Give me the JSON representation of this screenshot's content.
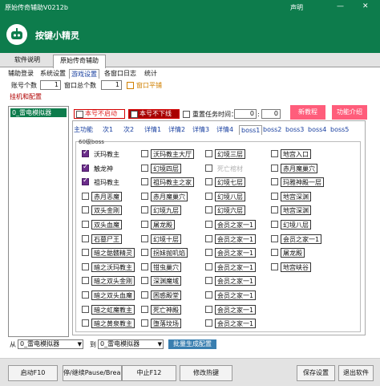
{
  "window": {
    "title": "原始传奇辅助V0212b",
    "announce_label": "声明",
    "min_icon": "minimize-icon",
    "close_icon": "close-icon"
  },
  "header": {
    "brand": "按键小精灵",
    "brand_color": "#0d7c4c"
  },
  "main_tabs": [
    "软件说明",
    "原始传奇辅助"
  ],
  "sub_tabs": [
    "辅助登录",
    "系统设置",
    "游戏设置",
    "各窗口日志",
    "统计"
  ],
  "settings": {
    "account_count_label": "账号个数",
    "account_count_value": "1",
    "window_total_label": "窗口总个数",
    "window_total_value": "1",
    "window_tile_label": "窗口平铺",
    "hang_config_tab": "挂机和配置"
  },
  "left_list": {
    "items": [
      "0_雷电模拟器"
    ]
  },
  "options": {
    "no_start_label": "本号不启动",
    "no_offline_label": "本号不下线",
    "restart_task_time_label": "重置任务时间：",
    "restart_hour": "0",
    "restart_min": "0",
    "new_tutorial": "新教程",
    "feature_intro": "功能介绍"
  },
  "function_tabs": [
    "主功能",
    "次1",
    "次2",
    "详情1",
    "详情2",
    "详情3",
    "详情4",
    "boss1",
    "boss2",
    "boss3",
    "boss4",
    "boss5"
  ],
  "boss_group_title": "60级boss",
  "boss_columns": [
    [
      {
        "label": "沃玛教主",
        "checked": true
      },
      {
        "label": "触龙神",
        "checked": true
      },
      {
        "label": "祖玛教主",
        "checked": true
      },
      {
        "label": "赤月恶魔",
        "checked": false
      },
      {
        "label": "双头金刚",
        "checked": false
      },
      {
        "label": "双头血魔",
        "checked": false
      },
      {
        "label": "石墓尸王",
        "checked": false
      },
      {
        "label": "暗之骷髅精灵",
        "checked": false
      },
      {
        "label": "暗之沃玛教主",
        "checked": false
      },
      {
        "label": "暗之双头金刚",
        "checked": false
      },
      {
        "label": "暗之双头血魔",
        "checked": false
      },
      {
        "label": "暗之虹魔教主",
        "checked": false
      },
      {
        "label": "暗之黄泉教主",
        "checked": false
      }
    ],
    [
      {
        "label": "沃玛教主大厅",
        "checked": false
      },
      {
        "label": "幻境四层",
        "checked": false
      },
      {
        "label": "祖玛教主之家",
        "checked": false
      },
      {
        "label": "赤月魔巢穴",
        "checked": false
      },
      {
        "label": "幻境九层",
        "checked": false
      },
      {
        "label": "屠龙殿",
        "checked": false
      },
      {
        "label": "幻境十层",
        "checked": false
      },
      {
        "label": "拐妹抛叽焰",
        "checked": false
      },
      {
        "label": "钳虫巢穴",
        "checked": false
      },
      {
        "label": "深渊魔域",
        "checked": false
      },
      {
        "label": "困惑殿堂",
        "checked": false
      },
      {
        "label": "死亡神殿",
        "checked": false
      },
      {
        "label": "堕落坟场",
        "checked": false
      }
    ],
    [
      {
        "label": "幻境三层",
        "checked": false
      },
      {
        "label": "死亡棺材",
        "checked": false,
        "disabled": true
      },
      {
        "label": "幻境七层",
        "checked": false
      },
      {
        "label": "幻境八层",
        "checked": false
      },
      {
        "label": "幻境六层",
        "checked": false
      },
      {
        "label": "会员之家一1",
        "checked": false
      },
      {
        "label": "会员之家一1",
        "checked": false
      },
      {
        "label": "会员之家一1",
        "checked": false
      },
      {
        "label": "会员之家一1",
        "checked": false
      },
      {
        "label": "会员之家一1",
        "checked": false
      },
      {
        "label": "会员之家一1",
        "checked": false
      },
      {
        "label": "会员之家一1",
        "checked": false
      },
      {
        "label": "会员之家一1",
        "checked": false
      }
    ],
    [
      {
        "label": "地宫入口",
        "checked": false
      },
      {
        "label": "赤月魔巢穴",
        "checked": false
      },
      {
        "label": "玛雅神殿一层",
        "checked": false
      },
      {
        "label": "地宫深渊",
        "checked": false
      },
      {
        "label": "地宫深渊",
        "checked": false
      },
      {
        "label": "幻境八层",
        "checked": false
      },
      {
        "label": "会员之家一1",
        "checked": false
      },
      {
        "label": "屠龙殿",
        "checked": false
      },
      {
        "label": "地宫峡谷",
        "checked": false
      }
    ]
  ],
  "bottom": {
    "from_label": "从",
    "from_value": "0_雷电模拟器",
    "to_label": "到",
    "to_value": "0_雷电模拟器",
    "batch_generate": "批量生成配置"
  },
  "footer": {
    "start": "启动F10",
    "pause": "停/继续Pause/Break",
    "stop": "中止F12",
    "hotkey": "修改热键",
    "save": "保存设置",
    "exit": "退出软件"
  }
}
